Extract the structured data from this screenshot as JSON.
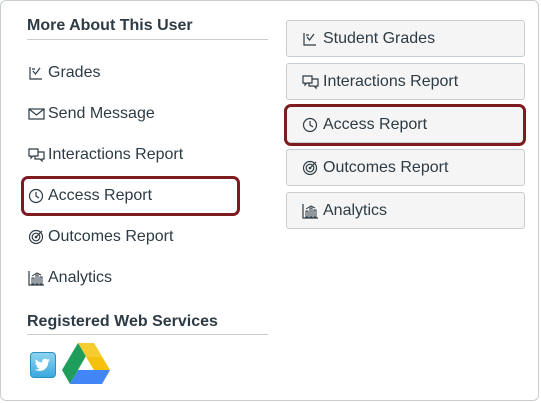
{
  "left_panel": {
    "heading": "More About This User",
    "links": [
      {
        "label": "Grades",
        "icon": "grades-icon"
      },
      {
        "label": "Send Message",
        "icon": "envelope-icon"
      },
      {
        "label": "Interactions Report",
        "icon": "chat-icon"
      },
      {
        "label": "Access Report",
        "icon": "clock-icon"
      },
      {
        "label": "Outcomes Report",
        "icon": "target-icon"
      },
      {
        "label": "Analytics",
        "icon": "bar-chart-icon"
      }
    ],
    "services_heading": "Registered Web Services",
    "services": [
      {
        "name": "twitter",
        "icon": "twitter-icon"
      },
      {
        "name": "google-drive",
        "icon": "google-drive-icon"
      }
    ]
  },
  "right_panel": {
    "buttons": [
      {
        "label": "Student Grades",
        "icon": "grades-icon"
      },
      {
        "label": "Interactions Report",
        "icon": "chat-icon"
      },
      {
        "label": "Access Report",
        "icon": "clock-icon"
      },
      {
        "label": "Outcomes Report",
        "icon": "target-icon"
      },
      {
        "label": "Analytics",
        "icon": "bar-chart-icon"
      }
    ]
  },
  "colors": {
    "text": "#2d3b45",
    "rule": "#c7cdd1",
    "highlight": "#7d1b1f",
    "button_bg": "#f5f5f5"
  }
}
